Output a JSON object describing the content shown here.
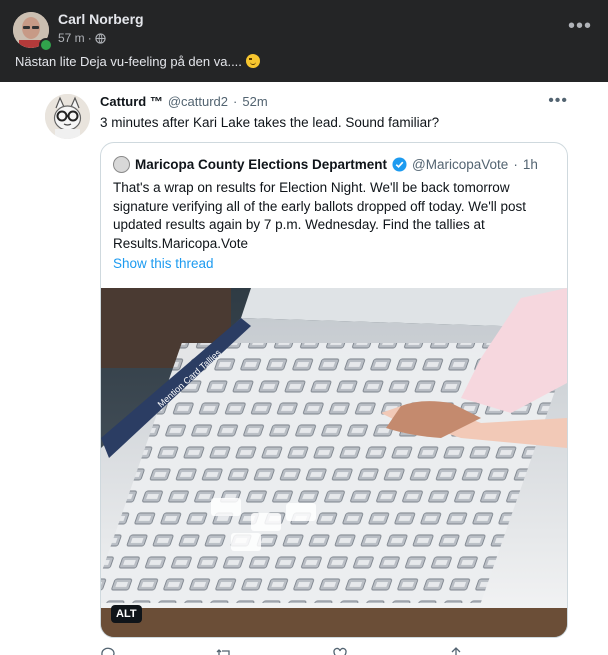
{
  "facebook_post": {
    "author": "Carl Norberg",
    "time": "57 m",
    "privacy_icon": "globe-icon",
    "text": "Nästan lite Deja vu-feeling på den va....",
    "emoji": "smiling-face-emoji",
    "more_label": "•••"
  },
  "tweet": {
    "author_name": "Catturd ™",
    "handle": "@catturd2",
    "time": "52m",
    "separator": "·",
    "text": "3 minutes after Kari Lake takes the lead. Sound familiar?",
    "more_label": "•••",
    "quoted": {
      "name": "Maricopa County Elections Department",
      "verified_icon": "verified-badge-icon",
      "handle": "@MaricopaVote",
      "time": "1h",
      "text": "That's a wrap on results for Election Night. We'll be back tomorrow signature verifying all of the early ballots dropped off today. We'll post updated results again by 7 p.m. Wednesday. Find the tallies at Results.Maricopa.Vote",
      "show_thread": "Show this thread",
      "photo_sign_text": "Mention Card Tallies",
      "alt_badge": "ALT"
    },
    "actions": [
      {
        "icon": "reply-icon",
        "count": ""
      },
      {
        "icon": "retweet-icon",
        "count": ""
      },
      {
        "icon": "like-icon",
        "count": ""
      },
      {
        "icon": "share-icon",
        "count": ""
      }
    ]
  },
  "colors": {
    "facebook_bg": "#242526",
    "twitter_link": "#1d9bf0",
    "verified": "#1d9bf0"
  }
}
